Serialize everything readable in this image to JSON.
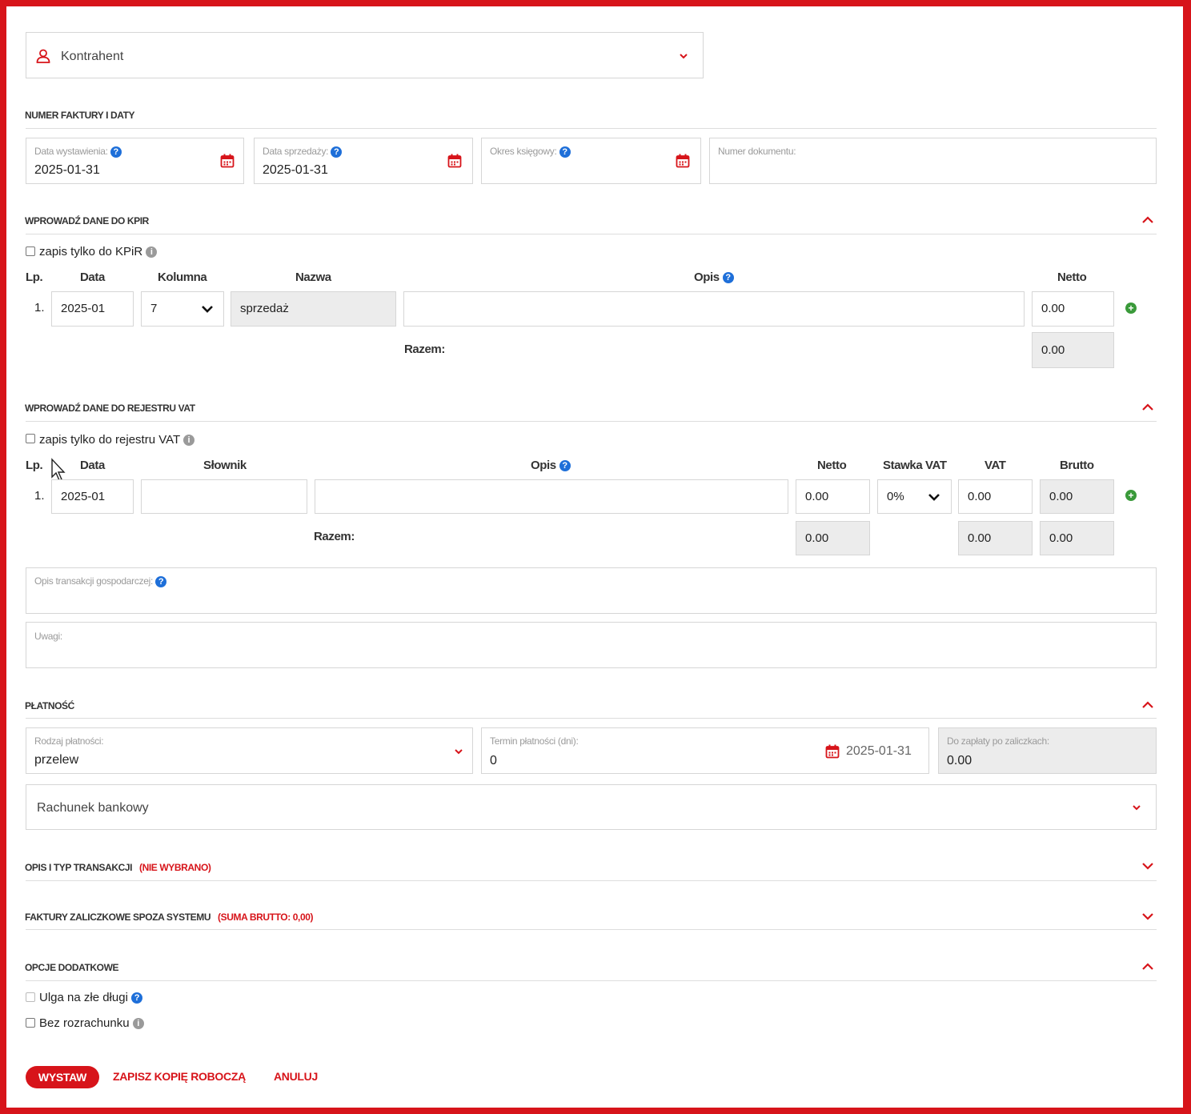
{
  "contractor": {
    "label": "Kontrahent"
  },
  "invoice_dates": {
    "section_title": "NUMER FAKTURY I DATY",
    "issue_date": {
      "label": "Data wystawienia:",
      "value": "2025-01-31"
    },
    "sale_date": {
      "label": "Data sprzedaży:",
      "value": "2025-01-31"
    },
    "accounting_period": {
      "label": "Okres księgowy:",
      "value": ""
    },
    "document_number": {
      "label": "Numer dokumentu:",
      "value": ""
    }
  },
  "kpir": {
    "section_title": "WPROWADŹ DANE DO KPIR",
    "only_kpir_label": "zapis tylko do KPiR",
    "headers": {
      "lp": "Lp.",
      "date": "Data",
      "column": "Kolumna",
      "name": "Nazwa",
      "desc": "Opis",
      "net": "Netto"
    },
    "row": {
      "lp": "1.",
      "date": "2025-01",
      "column": "7",
      "name": "sprzedaż",
      "desc": "",
      "net": "0.00"
    },
    "total_label": "Razem:",
    "total_net": "0.00"
  },
  "vat": {
    "section_title": "WPROWADŹ DANE DO REJESTRU VAT",
    "only_vat_label": "zapis tylko do rejestru VAT",
    "headers": {
      "lp": "Lp.",
      "date": "Data",
      "dict": "Słownik",
      "desc": "Opis",
      "net": "Netto",
      "rate": "Stawka VAT",
      "vat": "VAT",
      "gross": "Brutto"
    },
    "row": {
      "lp": "1.",
      "date": "2025-01",
      "dict": "",
      "desc": "",
      "net": "0.00",
      "rate": "0%",
      "vat": "0.00",
      "gross": "0.00"
    },
    "total_label": "Razem:",
    "total_net": "0.00",
    "total_vat": "0.00",
    "total_gross": "0.00"
  },
  "transaction_desc": {
    "label": "Opis transakcji gospodarczej:"
  },
  "notes": {
    "label": "Uwagi:"
  },
  "payment": {
    "section_title": "PŁATNOŚĆ",
    "method": {
      "label": "Rodzaj płatności:",
      "value": "przelew"
    },
    "term": {
      "label": "Termin płatności (dni):",
      "value": "0",
      "date": "2025-01-31"
    },
    "to_pay": {
      "label": "Do zapłaty po zaliczkach:",
      "value": "0.00"
    },
    "bank_account": "Rachunek bankowy"
  },
  "transaction_type": {
    "title": "OPIS I TYP TRANSAKCJI",
    "status": "(NIE WYBRANO)"
  },
  "advance_invoices": {
    "title": "FAKTURY ZALICZKOWE SPOZA SYSTEMU",
    "status": "(SUMA BRUTTO: 0,00)"
  },
  "extra_options": {
    "title": "OPCJE DODATKOWE",
    "bad_debt_label": "Ulga na złe długi",
    "no_settlement_label": "Bez rozrachunku"
  },
  "actions": {
    "issue": "WYSTAW",
    "save_draft": "ZAPISZ KOPIĘ ROBOCZĄ",
    "cancel": "ANULUJ"
  },
  "colors": {
    "accent": "#d7141a",
    "help": "#1e6fd9",
    "add": "#3a9a3a"
  }
}
